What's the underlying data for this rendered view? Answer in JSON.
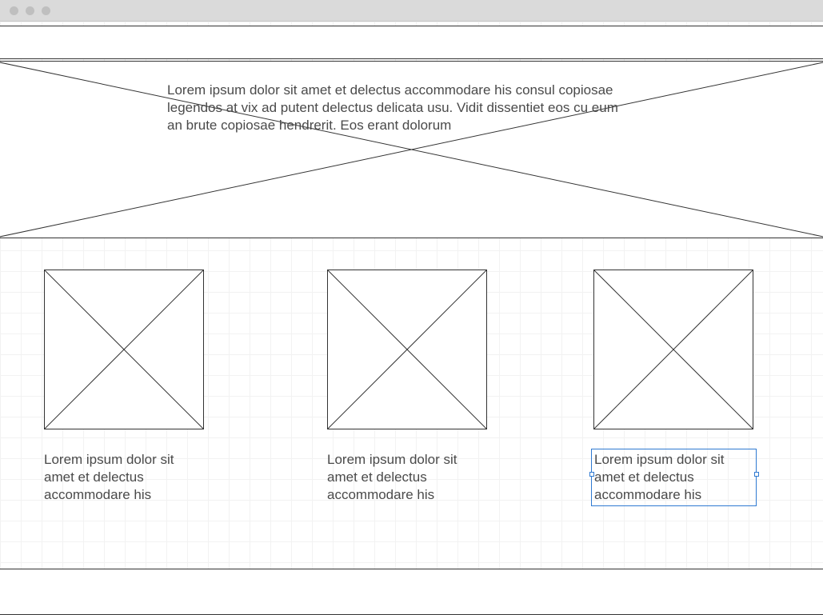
{
  "hero": {
    "text": "Lorem ipsum dolor sit amet et delectus accommodare his consul copiosae legendos at vix ad putent delectus delicata usu. Vidit dissentiet eos cu eum an brute copiosae hendrerit. Eos erant dolorum"
  },
  "cards": [
    {
      "caption": "Lorem ipsum dolor sit amet et delectus accommodare his"
    },
    {
      "caption": "Lorem ipsum dolor sit amet et delectus accommodare his"
    },
    {
      "caption": "Lorem ipsum dolor sit amet et delectus accommodare his"
    }
  ],
  "selection": {
    "index": 2
  }
}
